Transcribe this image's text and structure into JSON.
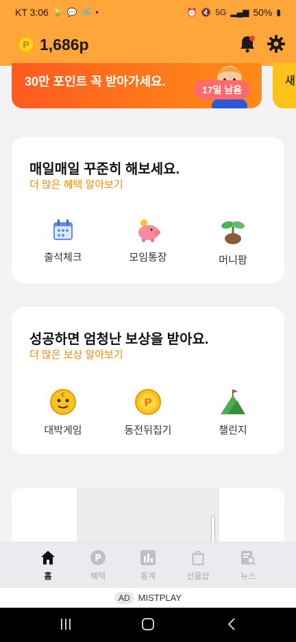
{
  "status_bar": {
    "carrier_time": "KT 3:06",
    "battery": "50%",
    "network": "5G"
  },
  "header": {
    "coin_symbol": "P",
    "points": "1,686p"
  },
  "banner": {
    "top_text": "",
    "headline": "30만 포인트 꼭 받아가세요.",
    "badge": "17일 남음",
    "peek_text": "새"
  },
  "daily_card": {
    "title": "매일매일 꾸준히 해보세요.",
    "link": "더 많은 혜택 알아보기",
    "items": [
      {
        "label": "출석체크",
        "icon": "calendar-icon"
      },
      {
        "label": "모임통장",
        "icon": "piggy-bank-icon"
      },
      {
        "label": "머니팜",
        "icon": "sprout-icon"
      }
    ]
  },
  "reward_card": {
    "title": "성공하면 엄청난 보상을 받아요.",
    "link": "더 많은 보상 알아보기",
    "items": [
      {
        "label": "대박게임",
        "icon": "game-coin-icon"
      },
      {
        "label": "동전뒤집기",
        "icon": "coin-flip-icon"
      },
      {
        "label": "챌린지",
        "icon": "mountain-flag-icon"
      }
    ]
  },
  "bottom_nav": {
    "items": [
      {
        "label": "홈",
        "icon": "home-icon",
        "active": true
      },
      {
        "label": "혜택",
        "icon": "point-icon",
        "active": false
      },
      {
        "label": "통계",
        "icon": "bar-chart-icon",
        "active": false
      },
      {
        "label": "선물샵",
        "icon": "shopping-bag-icon",
        "active": false
      },
      {
        "label": "뉴스",
        "icon": "news-search-icon",
        "active": false
      }
    ]
  },
  "ad_strip": {
    "badge": "AD",
    "text": "MISTPLAY"
  },
  "colors": {
    "header_bg": "#ffa63a",
    "accent": "#f08a00",
    "banner": "#ff6a1f"
  }
}
